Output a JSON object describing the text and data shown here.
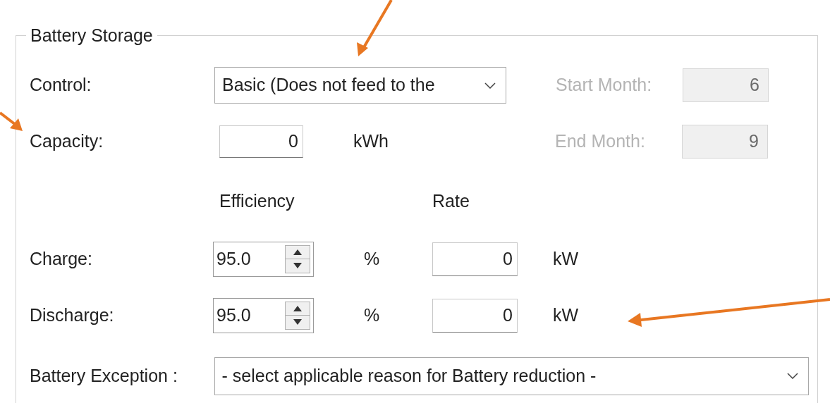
{
  "group": {
    "title": "Battery Storage"
  },
  "control": {
    "label": "Control:",
    "value": "Basic (Does not feed to the"
  },
  "start_month": {
    "label": "Start Month:",
    "value": "6",
    "disabled": true
  },
  "capacity": {
    "label": "Capacity:",
    "value": "0",
    "unit": "kWh"
  },
  "end_month": {
    "label": "End Month:",
    "value": "9",
    "disabled": true
  },
  "headers": [
    "Efficiency",
    "Rate"
  ],
  "rows": [
    {
      "label": "Charge:",
      "efficiency": "95.0",
      "efficiency_unit": "%",
      "rate": "0",
      "rate_unit": "kW"
    },
    {
      "label": "Discharge:",
      "efficiency": "95.0",
      "efficiency_unit": "%",
      "rate": "0",
      "rate_unit": "kW"
    }
  ],
  "exception": {
    "label": "Battery Exception :",
    "value": "- select applicable reason for Battery reduction -"
  }
}
